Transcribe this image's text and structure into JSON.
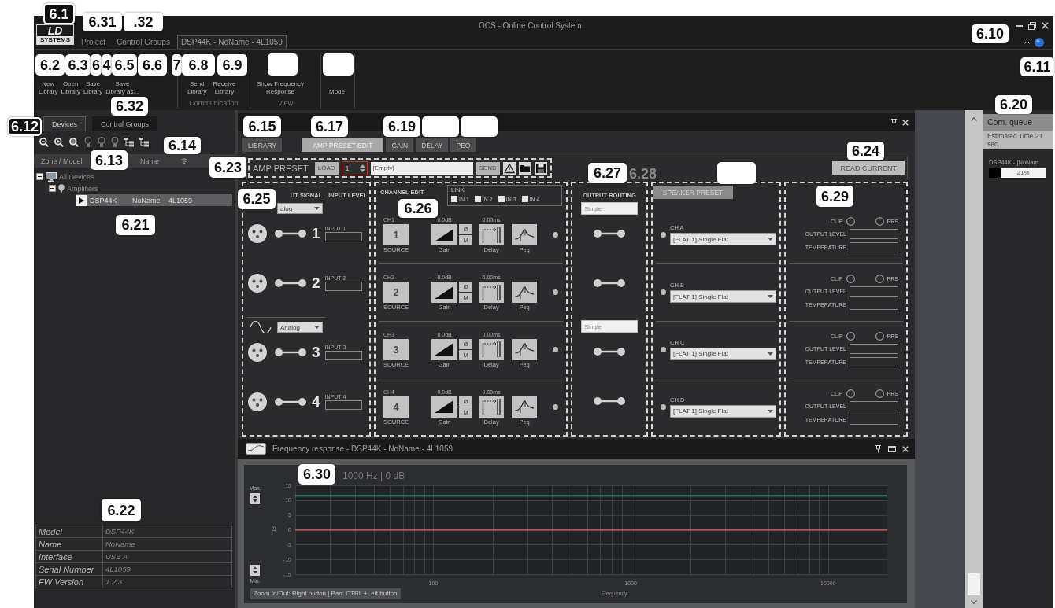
{
  "window": {
    "title": "OCS - Online Control System"
  },
  "logo": {
    "mark": "LD",
    "name": "SYSTEMS"
  },
  "menu_tabs": [
    {
      "label": "Project",
      "selected": false
    },
    {
      "label": "Control Groups",
      "selected": false
    },
    {
      "label": "DSP44K - NoName - 4L1059",
      "selected": true
    }
  ],
  "ribbon": [
    {
      "buttons": [
        "New\nLibrary",
        "Open\nLibrary",
        "Save\nLibrary",
        "Save\nLibrary as..."
      ]
    },
    {
      "label": "Communication",
      "buttons": [
        "Send\nLibrary",
        "Receive\nLibrary"
      ]
    },
    {
      "label": "View",
      "buttons": [
        "Show Frequency\nResponse"
      ]
    },
    {
      "buttons": [
        "Mode"
      ]
    }
  ],
  "devices_panel": {
    "tabs": [
      {
        "label": "Devices",
        "selected": true
      },
      {
        "label": "Control Groups",
        "selected": false
      }
    ],
    "columns": [
      "Zone / Model",
      "Name"
    ],
    "tree": [
      {
        "kind": "root",
        "label": "All Devices",
        "expanded": true,
        "selected": false,
        "children": [
          {
            "kind": "group",
            "label": "Amplifiers",
            "expanded": true,
            "selected": false,
            "children": [
              {
                "kind": "device",
                "cells": [
                  "DSP44K",
                  "NoName",
                  "4L1059"
                ],
                "selected": true
              }
            ]
          }
        ]
      }
    ],
    "properties": [
      {
        "label": "Model",
        "value": "DSP44K"
      },
      {
        "label": "Name",
        "value": "NoName"
      },
      {
        "label": "Interface",
        "value": "USB A"
      },
      {
        "label": "Serial Number",
        "value": "4L1059"
      },
      {
        "label": "FW Version",
        "value": "1.2.3"
      }
    ]
  },
  "editor": {
    "tabs": [
      {
        "label": "LIBRARY",
        "selected": false
      },
      {
        "label": "AMP PRESET EDIT",
        "selected": true
      },
      {
        "label": "GAIN",
        "selected": false
      },
      {
        "label": "DELAY",
        "selected": false
      },
      {
        "label": "PEQ",
        "selected": false
      }
    ],
    "amp_preset": {
      "label": "AMP PRESET",
      "load": "LOAD",
      "number": "1",
      "preset_name": "[Empty]",
      "send": "SEND"
    },
    "read_current": "READ CURRENT",
    "inputs": {
      "headers": [
        "UT SIGNAL",
        "INPUT LEVEL"
      ],
      "groups": [
        {
          "signal": "alog",
          "inputs": [
            {
              "number": "1",
              "label": "INPUT 1"
            },
            {
              "number": "2",
              "label": "INPUT 2"
            }
          ]
        },
        {
          "signal": "Analog",
          "inputs": [
            {
              "number": "3",
              "label": "INPUT 3"
            },
            {
              "number": "4",
              "label": "INPUT 4"
            }
          ]
        }
      ]
    },
    "channel_edit": {
      "title": "CHANNEL EDIT",
      "link": {
        "label": "LINK",
        "inputs": [
          {
            "label": "IN 1",
            "checked": false
          },
          {
            "label": "IN 2",
            "checked": false
          },
          {
            "label": "IN 3",
            "checked": false
          },
          {
            "label": "IN 4",
            "checked": false
          }
        ]
      },
      "channels": [
        {
          "name": "CH1",
          "source": "1",
          "source_label": "SOURCE",
          "gain": "0.0dB",
          "gain_label": "Gain",
          "phase": "Ø",
          "mute": "M",
          "delay": "0.00ms",
          "delay_label": "Delay",
          "peq_label": "Peq"
        },
        {
          "name": "CH2",
          "source": "2",
          "source_label": "SOURCE",
          "gain": "0.0dB",
          "gain_label": "Gain",
          "phase": "Ø",
          "mute": "M",
          "delay": "0.00ms",
          "delay_label": "Delay",
          "peq_label": "Peq"
        },
        {
          "name": "CH3",
          "source": "3",
          "source_label": "SOURCE",
          "gain": "0.0dB",
          "gain_label": "Gain",
          "phase": "Ø",
          "mute": "M",
          "delay": "0.00ms",
          "delay_label": "Delay",
          "peq_label": "Peq"
        },
        {
          "name": "CH4",
          "source": "4",
          "source_label": "SOURCE",
          "gain": "0.0dB",
          "gain_label": "Gain",
          "phase": "Ø",
          "mute": "M",
          "delay": "0.00ms",
          "delay_label": "Delay",
          "peq_label": "Peq"
        }
      ]
    },
    "output_routing": {
      "title": "OUTPUT ROUTING",
      "groups": [
        {
          "mode": "Single"
        },
        {
          "mode": "Single"
        }
      ]
    },
    "speaker_preset": {
      "button": {
        "label": "SPEAKER PRESET",
        "disabled": true
      },
      "channels": [
        {
          "name": "CH A",
          "preset": "[FLAT 1] Single Flat"
        },
        {
          "name": "CH B",
          "preset": "[FLAT 1] Single Flat"
        },
        {
          "name": "CH C",
          "preset": "[FLAT 1] Single Flat"
        },
        {
          "name": "CH D",
          "preset": "[FLAT 1] Single Flat"
        }
      ]
    },
    "monitor": [
      {
        "clip": "CLIP",
        "prs": "PRS",
        "output_level": "OUTPUT LEVEL",
        "temperature": "TEMPERATURE"
      },
      {
        "clip": "CLIP",
        "prs": "PRS",
        "output_level": "OUTPUT LEVEL",
        "temperature": "TEMPERATURE"
      },
      {
        "clip": "CLIP",
        "prs": "PRS",
        "output_level": "OUTPUT LEVEL",
        "temperature": "TEMPERATURE"
      },
      {
        "clip": "CLIP",
        "prs": "PRS",
        "output_level": "OUTPUT LEVEL",
        "temperature": "TEMPERATURE"
      }
    ]
  },
  "frequency_response": {
    "title": "Frequency response - DSP44K - NoName - 4L1059",
    "readout": "1000 Hz | 0 dB",
    "max_label": "Max.",
    "min_label": "Min.",
    "hint": "Zoom In/Out: Right button | Pan: CTRL +Left button",
    "chart_data": {
      "type": "line",
      "xlabel": "Frequency",
      "ylabel": "dB",
      "grid": true,
      "categories": [
        null,
        null,
        null,
        null,
        null,
        null,
        null,
        "100",
        null,
        null,
        null,
        null,
        null,
        null,
        null,
        null,
        null,
        "1000",
        null,
        null,
        null,
        null,
        null,
        null,
        null,
        null,
        null,
        "10000",
        null,
        null,
        null
      ],
      "series": [
        {
          "color": "#3f7f7c",
          "values": [
            11.5,
            11.5,
            11.5,
            11.5,
            11.5,
            11.5,
            11.5,
            11.5,
            11.5,
            11.5,
            11.5,
            11.5,
            11.5,
            11.5,
            11.5,
            11.5,
            11.5,
            11.5,
            11.5,
            11.5,
            11.5,
            11.5,
            11.5,
            11.5,
            11.5,
            11.5,
            11.5,
            11.5,
            11.5,
            11.5,
            11.5
          ]
        },
        {
          "color": "#c8505a",
          "values": [
            0,
            0,
            0,
            0,
            0,
            0,
            0,
            0,
            0,
            0,
            0,
            0,
            0,
            0,
            0,
            0,
            0,
            0,
            0,
            0,
            0,
            0,
            0,
            0,
            0,
            0,
            0,
            0,
            0,
            0,
            0
          ]
        }
      ],
      "ylim": [
        -15,
        15
      ],
      "yticks": [
        -15,
        -10,
        -5,
        0,
        5,
        10,
        15
      ]
    }
  },
  "com_queue": {
    "title": "Com. queue",
    "estimate": "Estimated Time 21 sec.",
    "jobs": [
      {
        "device": "DSP44K - [NoNam",
        "progress": "21%",
        "level": 0.21
      }
    ]
  },
  "callouts": [
    {
      "label": "6.1",
      "kind": "dark"
    },
    {
      "label": "6.31",
      "kind": "light"
    },
    {
      "label": ".32",
      "kind": "light"
    },
    {
      "label": "6.10",
      "kind": "light"
    },
    {
      "label": "6.2",
      "kind": "light"
    },
    {
      "label": "6.3",
      "kind": "light"
    },
    {
      "label": "6",
      "kind": "light"
    },
    {
      "label": "4",
      "kind": "light"
    },
    {
      "label": "6.5",
      "kind": "light"
    },
    {
      "label": "6.6",
      "kind": "light"
    },
    {
      "label": "7",
      "kind": "light"
    },
    {
      "label": "6.8",
      "kind": "light"
    },
    {
      "label": "6.9",
      "kind": "light"
    },
    {
      "kind": "blank"
    },
    {
      "kind": "blank"
    },
    {
      "label": "6.11",
      "kind": "light"
    },
    {
      "label": "6.32",
      "kind": "light"
    },
    {
      "label": "6.20",
      "kind": "light"
    },
    {
      "label": "6.12",
      "kind": "dark"
    },
    {
      "label": "6.15",
      "kind": "light"
    },
    {
      "label": "6.17",
      "kind": "light"
    },
    {
      "label": "6.19",
      "kind": "light"
    },
    {
      "kind": "blank"
    },
    {
      "kind": "blank"
    },
    {
      "label": "6.14",
      "kind": "light"
    },
    {
      "label": "6.24",
      "kind": "light"
    },
    {
      "label": "6.13",
      "kind": "light"
    },
    {
      "label": "6.23",
      "kind": "light"
    },
    {
      "kind": "blank"
    },
    {
      "label": "6.27",
      "kind": "light"
    },
    {
      "label": "6.28",
      "kind": "faded"
    },
    {
      "label": "6.25",
      "kind": "light"
    },
    {
      "label": "6.29",
      "kind": "light"
    },
    {
      "label": "6.26",
      "kind": "light"
    },
    {
      "label": "6.21",
      "kind": "light"
    },
    {
      "label": "6.30",
      "kind": "light"
    },
    {
      "label": "6.22",
      "kind": "light"
    }
  ]
}
